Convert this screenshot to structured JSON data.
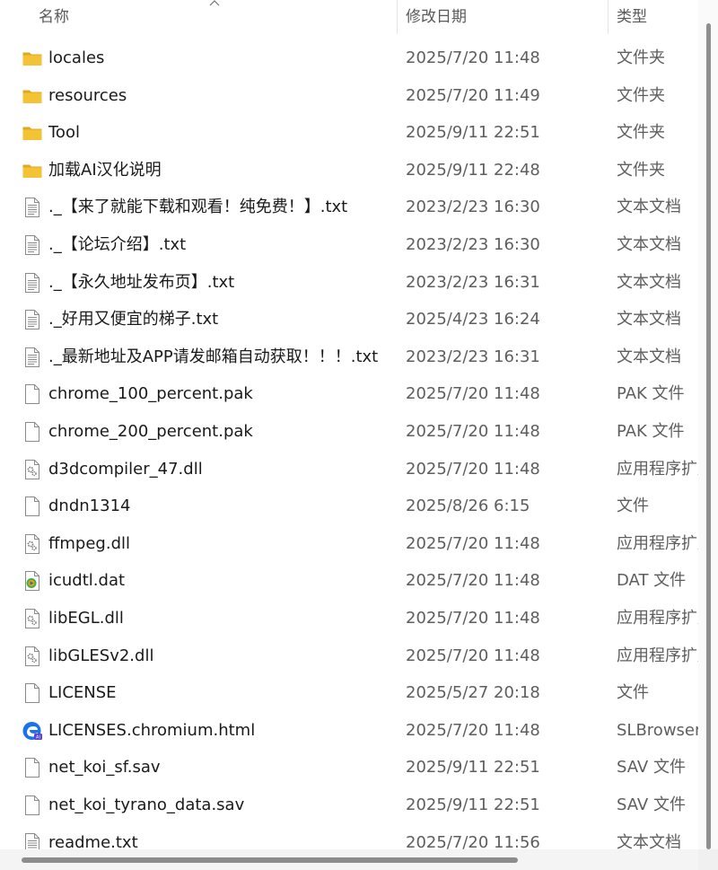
{
  "columns": {
    "name": "名称",
    "date": "修改日期",
    "type": "类型"
  },
  "files": [
    {
      "name": "locales",
      "date": "2025/7/20 11:48",
      "type": "文件夹",
      "icon": "folder-icon"
    },
    {
      "name": "resources",
      "date": "2025/7/20 11:49",
      "type": "文件夹",
      "icon": "folder-icon"
    },
    {
      "name": "Tool",
      "date": "2025/9/11 22:51",
      "type": "文件夹",
      "icon": "folder-icon"
    },
    {
      "name": "加载AI汉化说明",
      "date": "2025/9/11 22:48",
      "type": "文件夹",
      "icon": "folder-icon"
    },
    {
      "name": "._【来了就能下载和观看！纯免费！】.txt",
      "date": "2023/2/23 16:30",
      "type": "文本文档",
      "icon": "text-file-icon"
    },
    {
      "name": "._【论坛介绍】.txt",
      "date": "2023/2/23 16:30",
      "type": "文本文档",
      "icon": "text-file-icon"
    },
    {
      "name": "._【永久地址发布页】.txt",
      "date": "2023/2/23 16:31",
      "type": "文本文档",
      "icon": "text-file-icon"
    },
    {
      "name": "._好用又便宜的梯子.txt",
      "date": "2025/4/23 16:24",
      "type": "文本文档",
      "icon": "text-file-icon"
    },
    {
      "name": "._最新地址及APP请发邮箱自动获取！！！.txt",
      "date": "2023/2/23 16:31",
      "type": "文本文档",
      "icon": "text-file-icon"
    },
    {
      "name": "chrome_100_percent.pak",
      "date": "2025/7/20 11:48",
      "type": "PAK 文件",
      "icon": "blank-file-icon"
    },
    {
      "name": "chrome_200_percent.pak",
      "date": "2025/7/20 11:48",
      "type": "PAK 文件",
      "icon": "blank-file-icon"
    },
    {
      "name": "d3dcompiler_47.dll",
      "date": "2025/7/20 11:48",
      "type": "应用程序扩展",
      "icon": "dll-file-icon"
    },
    {
      "name": "dndn1314",
      "date": "2025/8/26 6:15",
      "type": "文件",
      "icon": "blank-file-icon"
    },
    {
      "name": "ffmpeg.dll",
      "date": "2025/7/20 11:48",
      "type": "应用程序扩展",
      "icon": "dll-file-icon"
    },
    {
      "name": "icudtl.dat",
      "date": "2025/7/20 11:48",
      "type": "DAT 文件",
      "icon": "media-file-icon"
    },
    {
      "name": "libEGL.dll",
      "date": "2025/7/20 11:48",
      "type": "应用程序扩展",
      "icon": "dll-file-icon"
    },
    {
      "name": "libGLESv2.dll",
      "date": "2025/7/20 11:48",
      "type": "应用程序扩展",
      "icon": "dll-file-icon"
    },
    {
      "name": "LICENSE",
      "date": "2025/5/27 20:18",
      "type": "文件",
      "icon": "blank-file-icon"
    },
    {
      "name": "LICENSES.chromium.html",
      "date": "2025/7/20 11:48",
      "type": "SLBrowser",
      "icon": "browser-file-icon"
    },
    {
      "name": "net_koi_sf.sav",
      "date": "2025/9/11 22:51",
      "type": "SAV 文件",
      "icon": "blank-file-icon"
    },
    {
      "name": "net_koi_tyrano_data.sav",
      "date": "2025/9/11 22:51",
      "type": "SAV 文件",
      "icon": "blank-file-icon"
    },
    {
      "name": "readme.txt",
      "date": "2025/7/20 11:56",
      "type": "文本文档",
      "icon": "text-file-icon"
    }
  ],
  "colors": {
    "folder": "#f4c235",
    "folder_dark": "#e0a81e",
    "accent": "#1f6feb"
  }
}
